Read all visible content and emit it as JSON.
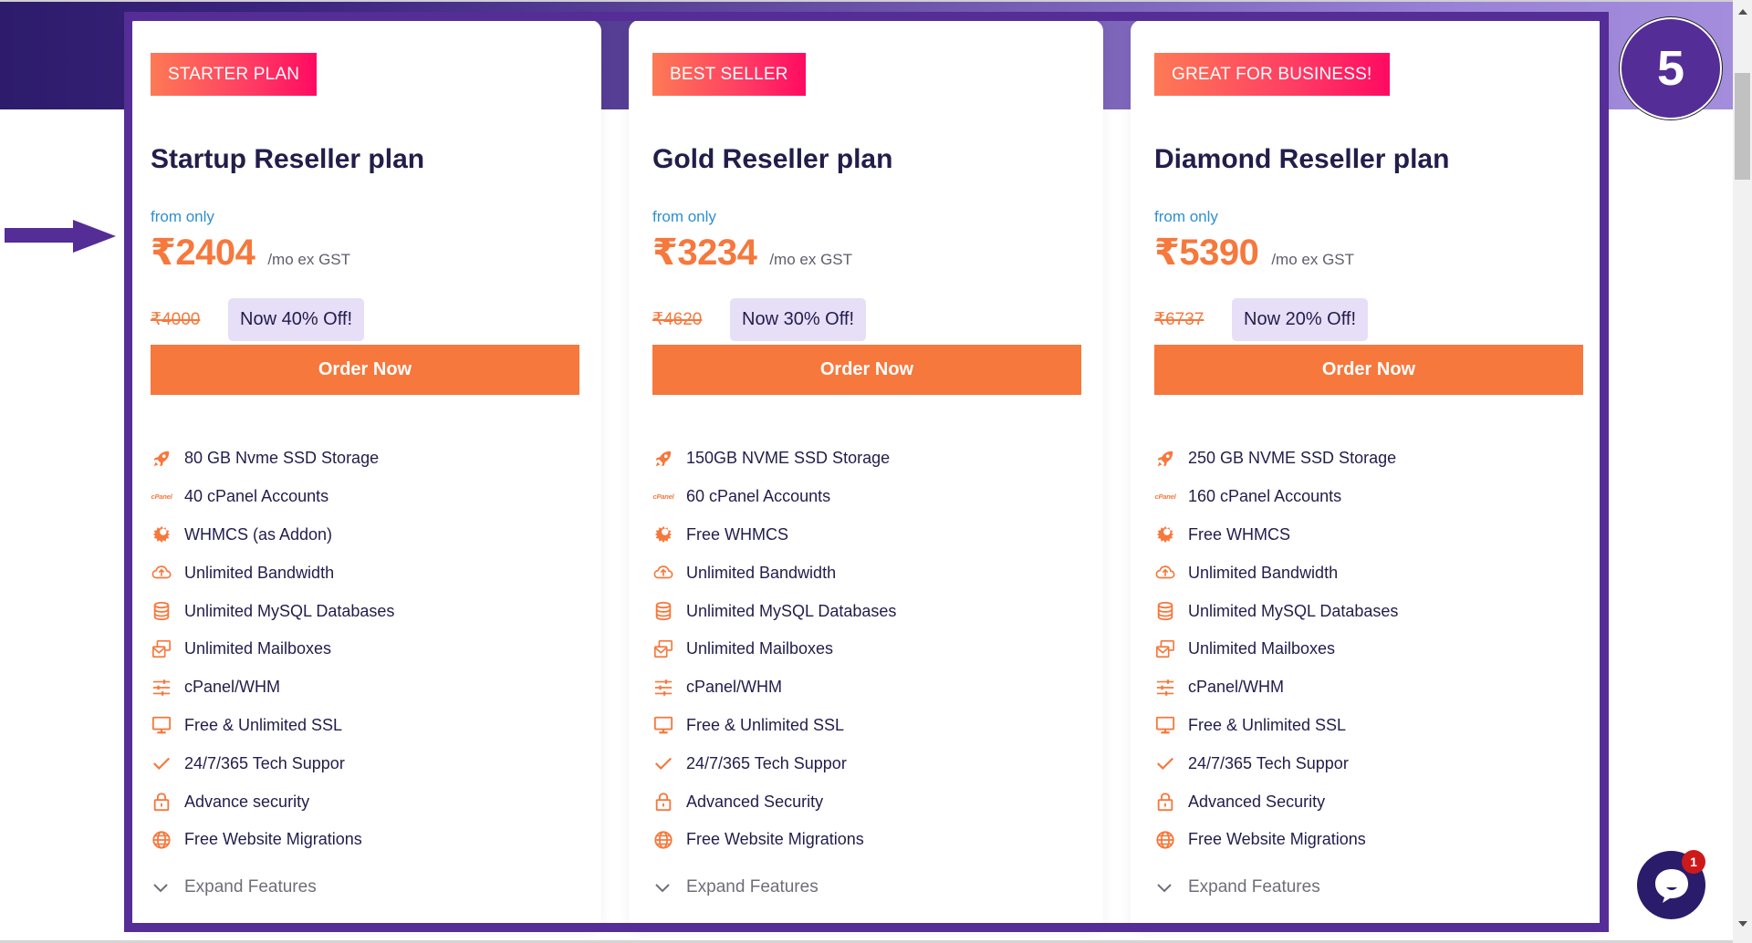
{
  "annotation": {
    "step_number": "5",
    "pointer": "arrow-pointing-right-at-first-plan-price"
  },
  "colors": {
    "accent_orange": "#f6783c",
    "highlight_purple": "#552d96",
    "badge_gradient_start": "#fd7a55",
    "badge_gradient_end": "#ff0a62",
    "discount_bg": "#e7def7",
    "title_navy": "#221d4a",
    "from_only_blue": "#2f8fcf"
  },
  "plans": [
    {
      "badge": "STARTER PLAN",
      "title": "Startup Reseller plan",
      "from_label": "from only",
      "price": "₹2404",
      "per": "/mo ex GST",
      "old_price": "₹4000",
      "discount": "Now 40% Off!",
      "order_label": "Order Now",
      "features": [
        {
          "icon": "rocket-icon",
          "text": "80 GB Nvme SSD Storage"
        },
        {
          "icon": "cpanel-icon",
          "text": "40 cPanel Accounts"
        },
        {
          "icon": "gear-icon",
          "text": "WHMCS (as Addon)"
        },
        {
          "icon": "cloud-upload-icon",
          "text": "Unlimited Bandwidth"
        },
        {
          "icon": "database-icon",
          "text": "Unlimited MySQL Databases"
        },
        {
          "icon": "mailbox-icon",
          "text": "Unlimited Mailboxes"
        },
        {
          "icon": "sliders-icon",
          "text": "cPanel/WHM"
        },
        {
          "icon": "monitor-icon",
          "text": "Free & Unlimited SSL"
        },
        {
          "icon": "check-icon",
          "text": "24/7/365 Tech Suppor"
        },
        {
          "icon": "lock-icon",
          "text": "Advance security"
        },
        {
          "icon": "globe-icon",
          "text": "Free Website Migrations"
        }
      ],
      "expand_label": "Expand Features"
    },
    {
      "badge": "BEST SELLER",
      "title": "Gold Reseller plan",
      "from_label": "from only",
      "price": "₹3234",
      "per": "/mo ex GST",
      "old_price": "₹4620",
      "discount": "Now 30% Off!",
      "order_label": "Order Now",
      "features": [
        {
          "icon": "rocket-icon",
          "text": "150GB NVME SSD Storage"
        },
        {
          "icon": "cpanel-icon",
          "text": "60 cPanel Accounts"
        },
        {
          "icon": "gear-icon",
          "text": "Free WHMCS"
        },
        {
          "icon": "cloud-upload-icon",
          "text": "Unlimited Bandwidth"
        },
        {
          "icon": "database-icon",
          "text": "Unlimited MySQL Databases"
        },
        {
          "icon": "mailbox-icon",
          "text": "Unlimited Mailboxes"
        },
        {
          "icon": "sliders-icon",
          "text": "cPanel/WHM"
        },
        {
          "icon": "monitor-icon",
          "text": "Free & Unlimited SSL"
        },
        {
          "icon": "check-icon",
          "text": "24/7/365 Tech Suppor"
        },
        {
          "icon": "lock-icon",
          "text": "Advanced Security"
        },
        {
          "icon": "globe-icon",
          "text": "Free Website Migrations"
        }
      ],
      "expand_label": "Expand Features"
    },
    {
      "badge": "GREAT FOR BUSINESS!",
      "title": "Diamond Reseller plan",
      "from_label": "from only",
      "price": "₹5390",
      "per": "/mo ex GST",
      "old_price": "₹6737",
      "discount": "Now 20% Off!",
      "order_label": "Order Now",
      "features": [
        {
          "icon": "rocket-icon",
          "text": "250 GB NVME SSD Storage"
        },
        {
          "icon": "cpanel-icon",
          "text": "160 cPanel Accounts"
        },
        {
          "icon": "gear-icon",
          "text": "Free WHMCS"
        },
        {
          "icon": "cloud-upload-icon",
          "text": "Unlimited Bandwidth"
        },
        {
          "icon": "database-icon",
          "text": "Unlimited MySQL Databases"
        },
        {
          "icon": "mailbox-icon",
          "text": "Unlimited Mailboxes"
        },
        {
          "icon": "sliders-icon",
          "text": "cPanel/WHM"
        },
        {
          "icon": "monitor-icon",
          "text": "Free & Unlimited SSL"
        },
        {
          "icon": "check-icon",
          "text": "24/7/365 Tech Suppor"
        },
        {
          "icon": "lock-icon",
          "text": "Advanced Security"
        },
        {
          "icon": "globe-icon",
          "text": "Free Website Migrations"
        }
      ],
      "expand_label": "Expand Features"
    }
  ],
  "icon_glyphs": {
    "cpanel-icon": "cPanel"
  },
  "chat": {
    "icon": "chat-bubble-icon",
    "unread_count": "1"
  },
  "scrollbar": {
    "position_fraction": 0.08
  }
}
